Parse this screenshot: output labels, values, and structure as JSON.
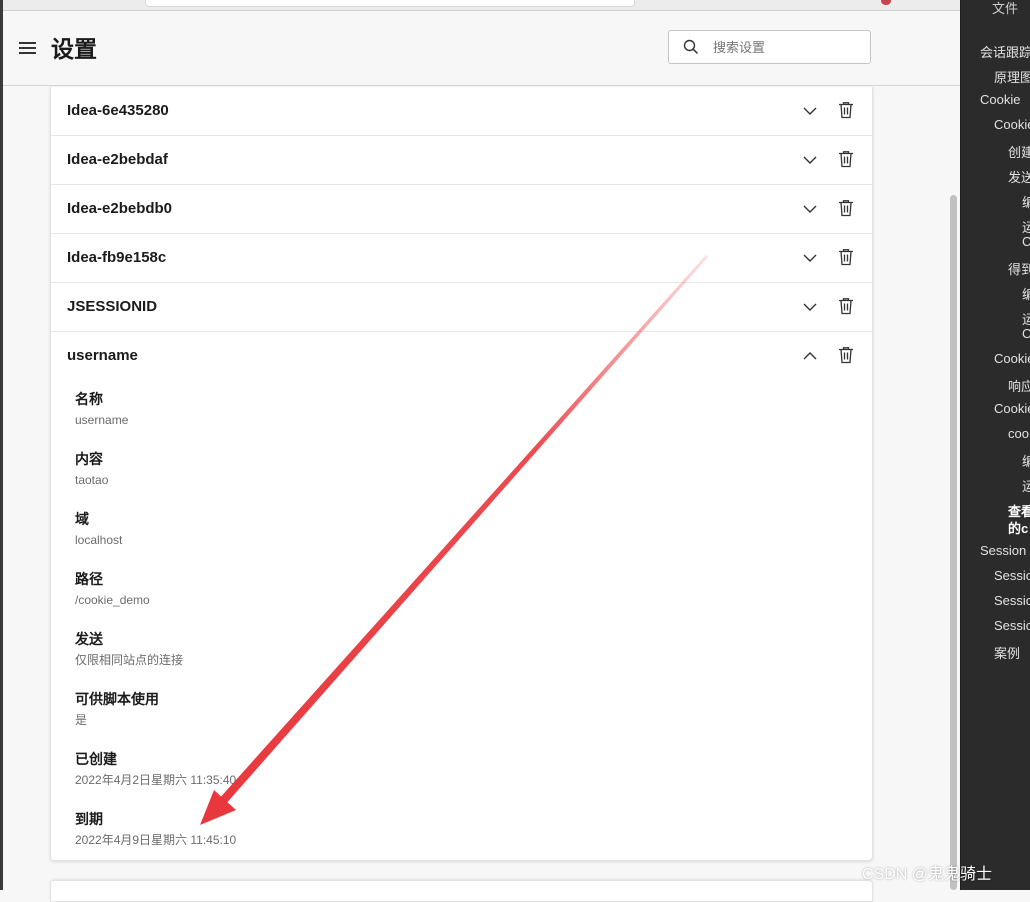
{
  "header": {
    "title": "设置",
    "search_placeholder": "搜索设置"
  },
  "cookies": [
    {
      "name": "Idea-6e435280",
      "expanded": false
    },
    {
      "name": "Idea-e2bebdaf",
      "expanded": false
    },
    {
      "name": "Idea-e2bebdb0",
      "expanded": false
    },
    {
      "name": "Idea-fb9e158c",
      "expanded": false
    },
    {
      "name": "JSESSIONID",
      "expanded": false
    },
    {
      "name": "username",
      "expanded": true
    }
  ],
  "details": [
    {
      "label": "名称",
      "value": "username"
    },
    {
      "label": "内容",
      "value": "taotao"
    },
    {
      "label": "域",
      "value": "localhost"
    },
    {
      "label": "路径",
      "value": "/cookie_demo"
    },
    {
      "label": "发送",
      "value": "仅限相同站点的连接"
    },
    {
      "label": "可供脚本使用",
      "value": "是"
    },
    {
      "label": "已创建",
      "value": "2022年4月2日星期六 11:35:40"
    },
    {
      "label": "到期",
      "value": "2022年4月9日星期六 11:45:10"
    }
  ],
  "outline": [
    {
      "text": "文件"
    },
    {
      "text": "会话跟踪"
    },
    {
      "text": "原理图"
    },
    {
      "text": "Cookie"
    },
    {
      "text": "Cookie"
    },
    {
      "text": "创建"
    },
    {
      "text": "发送"
    },
    {
      "text": "编"
    },
    {
      "text": "运"
    },
    {
      "text": "C"
    },
    {
      "text": "得到"
    },
    {
      "text": "编"
    },
    {
      "text": "运"
    },
    {
      "text": "C"
    },
    {
      "text": "Cookie"
    },
    {
      "text": "响应"
    },
    {
      "text": "Cookie"
    },
    {
      "text": "coo"
    },
    {
      "text": "编"
    },
    {
      "text": "运"
    },
    {
      "text": "查看"
    },
    {
      "text": "的c"
    },
    {
      "text": "Session"
    },
    {
      "text": "Sessio"
    },
    {
      "text": "Sessio"
    },
    {
      "text": "Sessio"
    },
    {
      "text": "案例"
    }
  ],
  "watermark": "CSDN @鬼鬼骑士",
  "colors": {
    "arrow": "#e8383d",
    "outline_bg": "#2b2b2b"
  }
}
